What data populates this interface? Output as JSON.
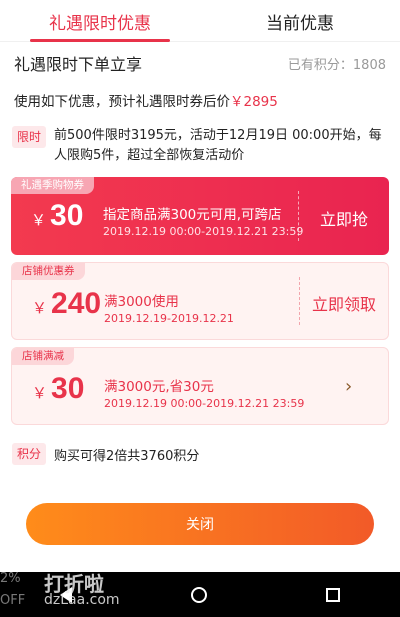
{
  "tabs": [
    {
      "label": "礼遇限时优惠"
    },
    {
      "label": "当前优惠"
    }
  ],
  "subhead": {
    "title": "礼遇限时下单立享",
    "points": "已有积分：1808"
  },
  "estimate": {
    "text": "使用如下优惠，预计礼遇限时券后价",
    "price": "￥2895"
  },
  "limit": {
    "tag": "限时",
    "text": "前500件限时3195元，活动于12月19日 00:00开始，每人限购5件，超过全部恢复活动价"
  },
  "coupons": [
    {
      "tag": "礼遇季购物券",
      "currency": "￥",
      "amount": "30",
      "desc": "指定商品满300元可用,可跨店",
      "date": "2019.12.19 00:00-2019.12.21 23:59",
      "action": "立即抢"
    },
    {
      "tag": "店铺优惠券",
      "currency": "￥",
      "amount": "240",
      "desc": "满3000使用",
      "date": "2019.12.19-2019.12.21",
      "action": "立即领取"
    },
    {
      "tag": "店铺满减",
      "currency": "￥",
      "amount": "30",
      "desc": "满3000元,省30元",
      "date": "2019.12.19 00:00-2019.12.21 23:59",
      "action": "›"
    }
  ],
  "points_info": {
    "tag": "积分",
    "text": "购买可得2倍共3760积分"
  },
  "close_button": "关闭",
  "watermark": {
    "main": "打折啦",
    "domain": "dzLaa.com",
    "side": "2%\nOFF"
  },
  "colors": {
    "accent": "#e8334a",
    "button_start": "#ff8c1a",
    "button_end": "#f25a28"
  }
}
